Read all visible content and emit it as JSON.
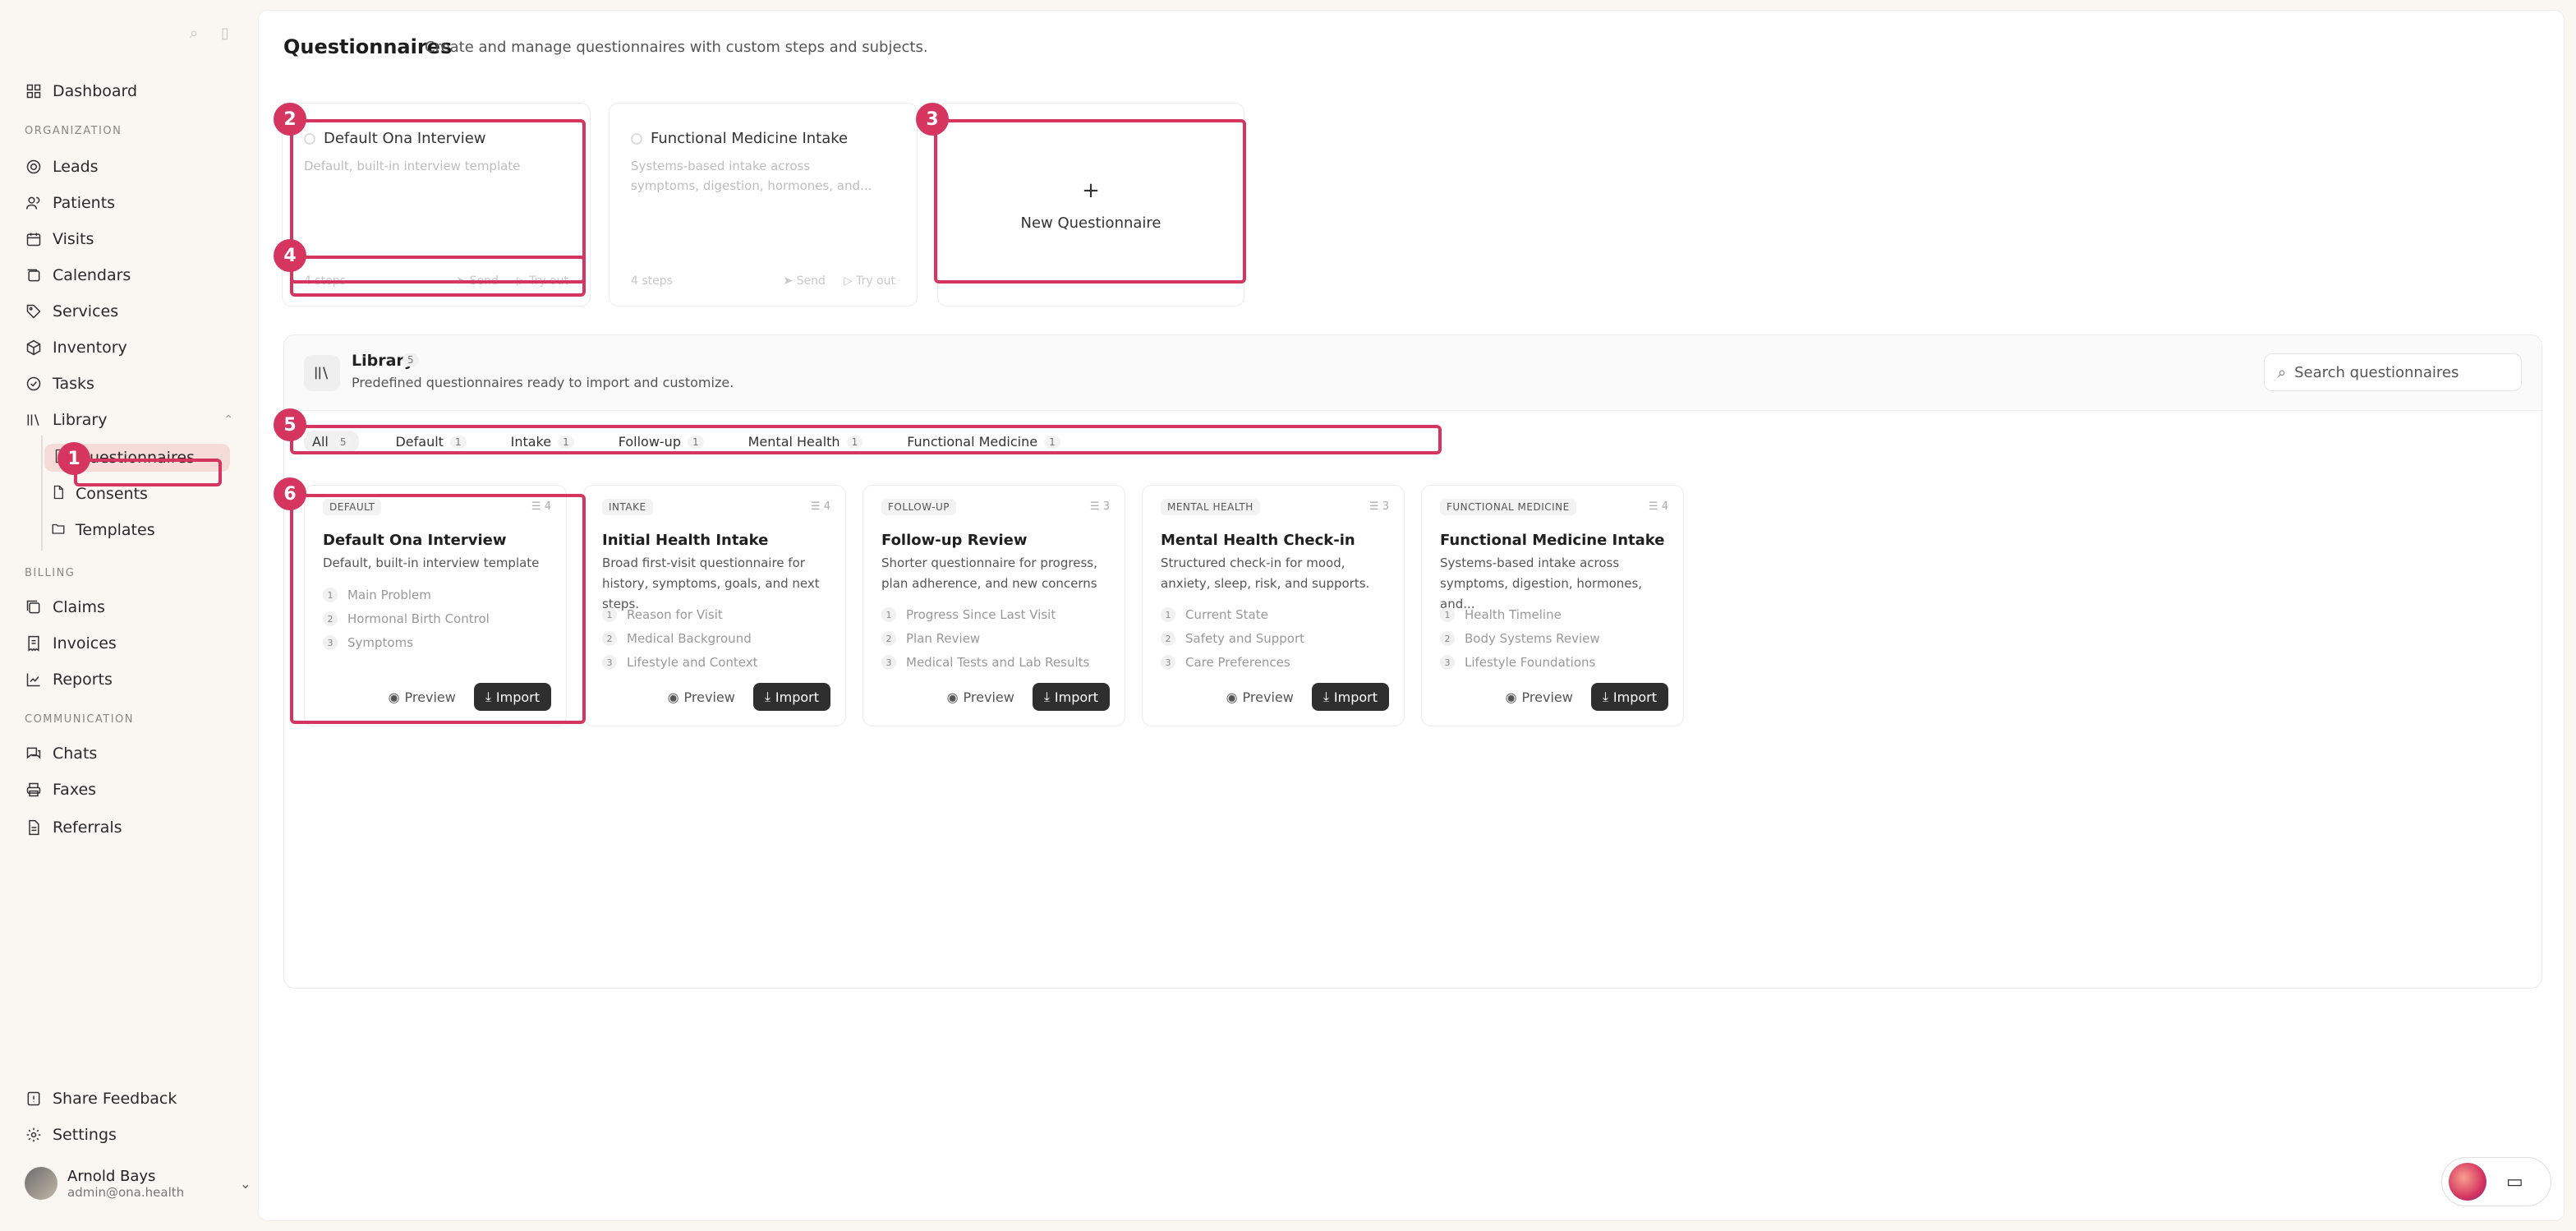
{
  "sidebar": {
    "items_top": [
      {
        "label": "Dashboard",
        "icon": "grid-icon"
      }
    ],
    "sections": {
      "organization": "ORGANIZATION",
      "billing": "BILLING",
      "communication": "COMMUNICATION"
    },
    "org_items": [
      {
        "label": "Leads"
      },
      {
        "label": "Patients"
      },
      {
        "label": "Calendars"
      },
      {
        "label": "Visits"
      },
      {
        "label": "Services"
      },
      {
        "label": "Inventory"
      },
      {
        "label": "Tasks"
      },
      {
        "label": "Library"
      }
    ],
    "library_sub": [
      {
        "label": "Questionnaires"
      },
      {
        "label": "Consents"
      },
      {
        "label": "Templates"
      }
    ],
    "billing_items": [
      {
        "label": "Claims"
      },
      {
        "label": "Invoices"
      },
      {
        "label": "Reports"
      }
    ],
    "comm_items": [
      {
        "label": "Chats"
      },
      {
        "label": "Faxes"
      },
      {
        "label": "Referrals"
      }
    ],
    "bottom_items": [
      {
        "label": "Share Feedback"
      },
      {
        "label": "Settings"
      }
    ],
    "user": {
      "name": "Arnold Bays",
      "email": "admin@ona.health"
    }
  },
  "header": {
    "title": "Questionnaires",
    "subtitle": "Create and manage questionnaires with custom steps and subjects."
  },
  "my_questionnaires": [
    {
      "title": "Default Ona Interview",
      "description": "Default, built-in interview template",
      "steps": "4 steps",
      "send": "Send",
      "try": "Try out"
    },
    {
      "title": "Functional Medicine Intake",
      "description": "Systems-based intake across symptoms, digestion, hormones, and...",
      "steps": "4 steps",
      "send": "Send",
      "try": "Try out"
    }
  ],
  "new_questionnaire": {
    "plus": "+",
    "label": "New Questionnaire"
  },
  "library": {
    "title": "Library",
    "count": "5",
    "subtitle": "Predefined questionnaires ready to import and customize.",
    "search_placeholder": "Search questionnaires",
    "tabs": [
      {
        "label": "All",
        "count": "5"
      },
      {
        "label": "Default",
        "count": "1"
      },
      {
        "label": "Intake",
        "count": "1"
      },
      {
        "label": "Follow-up",
        "count": "1"
      },
      {
        "label": "Mental Health",
        "count": "1"
      },
      {
        "label": "Functional Medicine",
        "count": "1"
      }
    ],
    "cards": [
      {
        "badge": "DEFAULT",
        "steps": "4",
        "title": "Default Ona Interview",
        "description": "Default, built-in interview template",
        "items": [
          "Main Problem",
          "Hormonal Birth Control",
          "Symptoms"
        ]
      },
      {
        "badge": "INTAKE",
        "steps": "4",
        "title": "Initial Health Intake",
        "description": "Broad first-visit questionnaire for history, symptoms, goals, and next steps.",
        "items": [
          "Reason for Visit",
          "Medical Background",
          "Lifestyle and Context"
        ]
      },
      {
        "badge": "FOLLOW-UP",
        "steps": "3",
        "title": "Follow-up Review",
        "description": "Shorter questionnaire for progress, plan adherence, and new concerns",
        "items": [
          "Progress Since Last Visit",
          "Plan Review",
          "Medical Tests and Lab Results"
        ]
      },
      {
        "badge": "MENTAL HEALTH",
        "steps": "3",
        "title": "Mental Health Check-in",
        "description": "Structured check-in for mood, anxiety, sleep, risk, and supports.",
        "items": [
          "Current State",
          "Safety and Support",
          "Care Preferences"
        ]
      },
      {
        "badge": "FUNCTIONAL MEDICINE",
        "steps": "4",
        "title": "Functional Medicine Intake",
        "description": "Systems-based intake across symptoms, digestion, hormones, and...",
        "items": [
          "Health Timeline",
          "Body Systems Review",
          "Lifestyle Foundations"
        ]
      }
    ],
    "preview_label": "Preview",
    "import_label": "Import"
  },
  "annotations": [
    "1",
    "2",
    "3",
    "4",
    "5",
    "6"
  ],
  "colors": {
    "annotation": "#d6355f",
    "import_button": "#2f2f2f"
  }
}
